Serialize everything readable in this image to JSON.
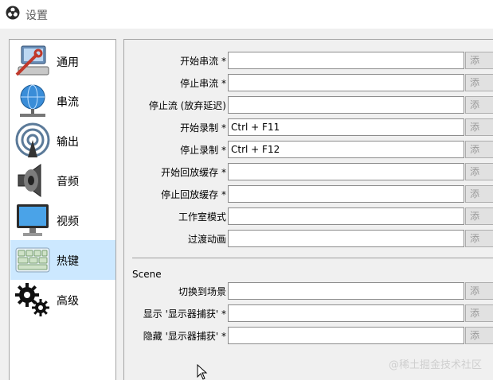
{
  "window": {
    "title": "设置"
  },
  "sidebar": {
    "items": [
      {
        "label": "通用",
        "icon": "computer-wrench-icon",
        "selected": false
      },
      {
        "label": "串流",
        "icon": "globe-network-icon",
        "selected": false
      },
      {
        "label": "输出",
        "icon": "broadcast-antenna-icon",
        "selected": false
      },
      {
        "label": "音频",
        "icon": "speaker-icon",
        "selected": false
      },
      {
        "label": "视频",
        "icon": "monitor-icon",
        "selected": false
      },
      {
        "label": "热键",
        "icon": "keyboard-icon",
        "selected": true
      },
      {
        "label": "高级",
        "icon": "gears-icon",
        "selected": false
      }
    ]
  },
  "hotkeys": {
    "general": [
      {
        "label": "开始串流 *",
        "value": ""
      },
      {
        "label": "停止串流 *",
        "value": ""
      },
      {
        "label": "停止流 (放弃延迟)",
        "value": ""
      },
      {
        "label": "开始录制 *",
        "value": "Ctrl + F11"
      },
      {
        "label": "停止录制 *",
        "value": "Ctrl + F12"
      },
      {
        "label": "开始回放缓存 *",
        "value": ""
      },
      {
        "label": "停止回放缓存 *",
        "value": ""
      },
      {
        "label": "工作室模式",
        "value": ""
      },
      {
        "label": "过渡动画",
        "value": ""
      }
    ],
    "scene_group_label": "Scene",
    "scene": [
      {
        "label": "切换到场景",
        "value": ""
      },
      {
        "label": "显示 '显示器捕获' *",
        "value": ""
      },
      {
        "label": "隐藏 '显示器捕获' *",
        "value": ""
      }
    ],
    "row_button_label": "添"
  },
  "watermark": "@稀土掘金技术社区",
  "colors": {
    "selected_bg": "#cce8ff",
    "panel_bg": "#f0f0f0",
    "border": "#a5a5a5"
  }
}
